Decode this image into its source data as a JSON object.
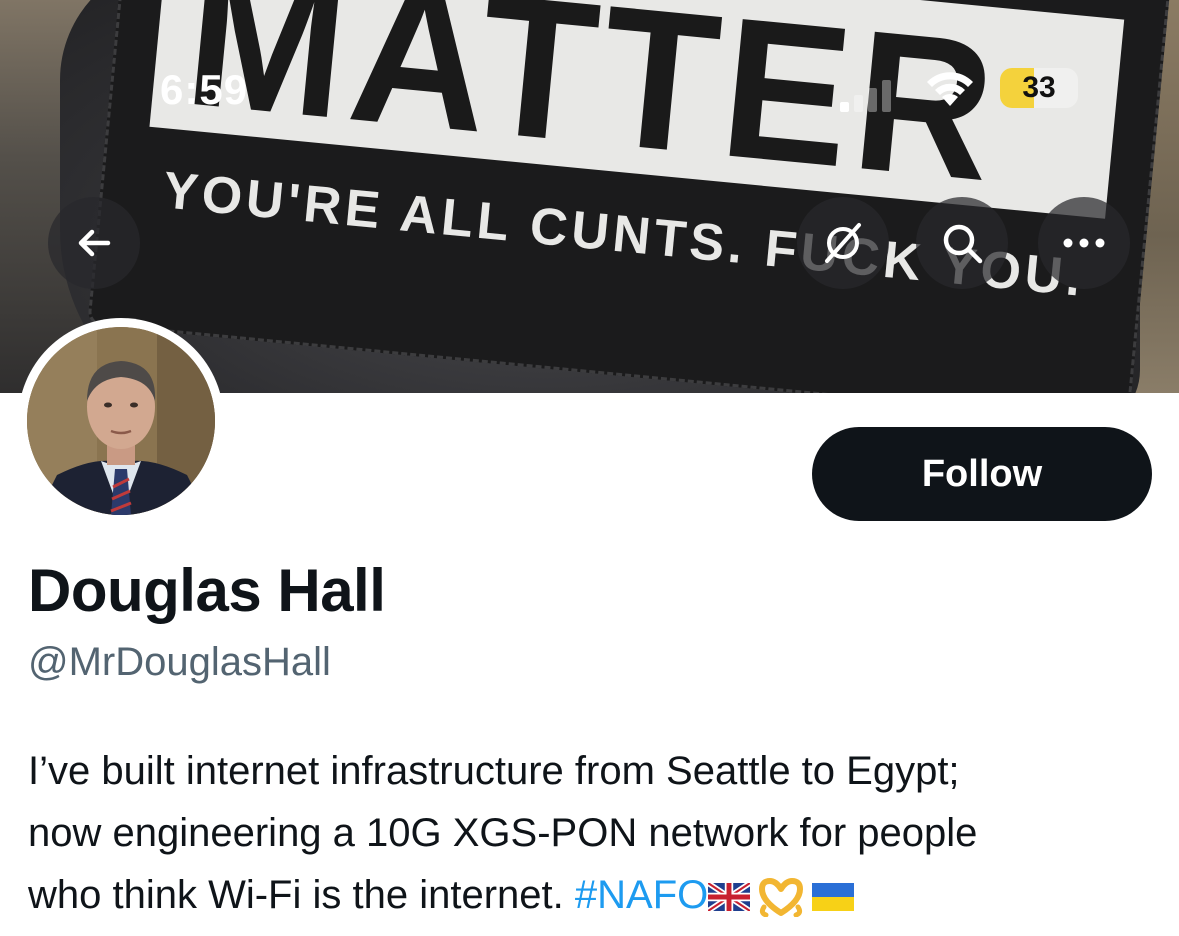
{
  "status_bar": {
    "time": "6:59",
    "battery_level": "33",
    "battery_color": "#f4d23c",
    "signal_icon": "cellular-signal-icon",
    "wifi_icon": "wifi-icon"
  },
  "banner": {
    "patch_big_text": "MATTER",
    "patch_small_text": "YOU'RE ALL CUNTS. FUCK YOU."
  },
  "header_buttons": {
    "back_icon": "back-arrow-icon",
    "grok_icon": "grok-icon",
    "search_icon": "search-icon",
    "more_icon": "more-icon"
  },
  "profile": {
    "follow_label": "Follow",
    "name": "Douglas Hall",
    "handle": "@MrDouglasHall",
    "bio_line_1": "I’ve built internet infrastructure from Seattle to Egypt;",
    "bio_line_2": "now engineering a 10G XGS-PON network for people",
    "bio_line_3": "who think Wi-Fi is the internet.",
    "bio_hashtag": "#NAFO",
    "bio_emojis": [
      "uk-flag-icon",
      "heart-hands-icon",
      "ukraine-flag-icon"
    ]
  },
  "colors": {
    "text_primary": "#0f1419",
    "text_secondary": "#536471",
    "link": "#1d9bf0",
    "follow_bg": "#0f1419"
  }
}
